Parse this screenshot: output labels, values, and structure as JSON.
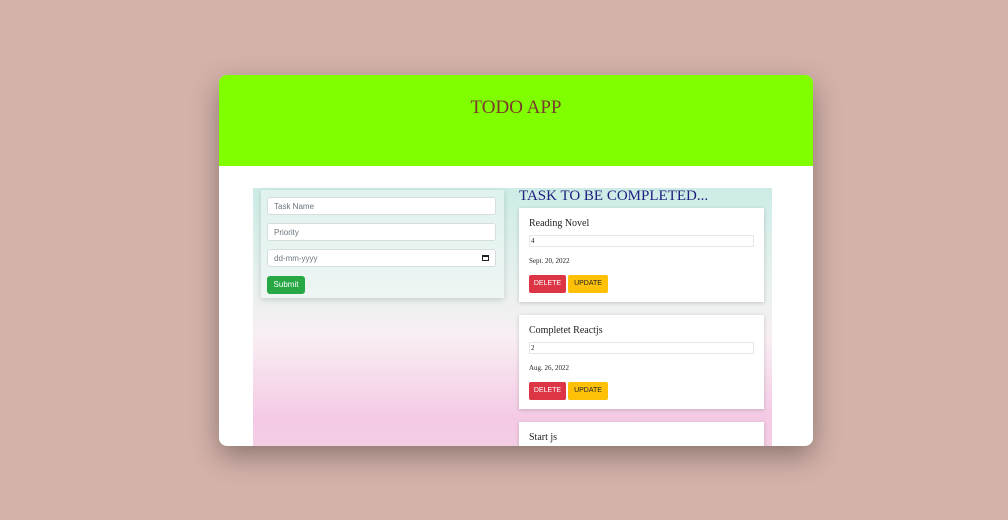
{
  "header": {
    "title": "TODO APP"
  },
  "form": {
    "task_name_placeholder": "Task Name",
    "priority_placeholder": "Priority",
    "date_placeholder": "dd-mm-yyyy",
    "submit_label": "Submit"
  },
  "list": {
    "heading": "TASK TO BE COMPLETED...",
    "tasks": [
      {
        "name": "Reading Novel",
        "priority": "4",
        "date": "Sept. 20, 2022",
        "delete_label": "DELETE",
        "update_label": "UPDATE"
      },
      {
        "name": "Completet Reactjs",
        "priority": "2",
        "date": "Aug. 26, 2022",
        "delete_label": "DELETE",
        "update_label": "UPDATE"
      },
      {
        "name": "Start js"
      }
    ]
  },
  "colors": {
    "page_background": "#d4b2aa",
    "header_background": "#80ff00",
    "title_color": "#7b3b2b",
    "heading_color": "#1d1f7e",
    "submit_button": "#28a745",
    "delete_button": "#dc3545",
    "update_button": "#ffc107"
  },
  "icons": {
    "date_picker": "calendar-icon"
  }
}
